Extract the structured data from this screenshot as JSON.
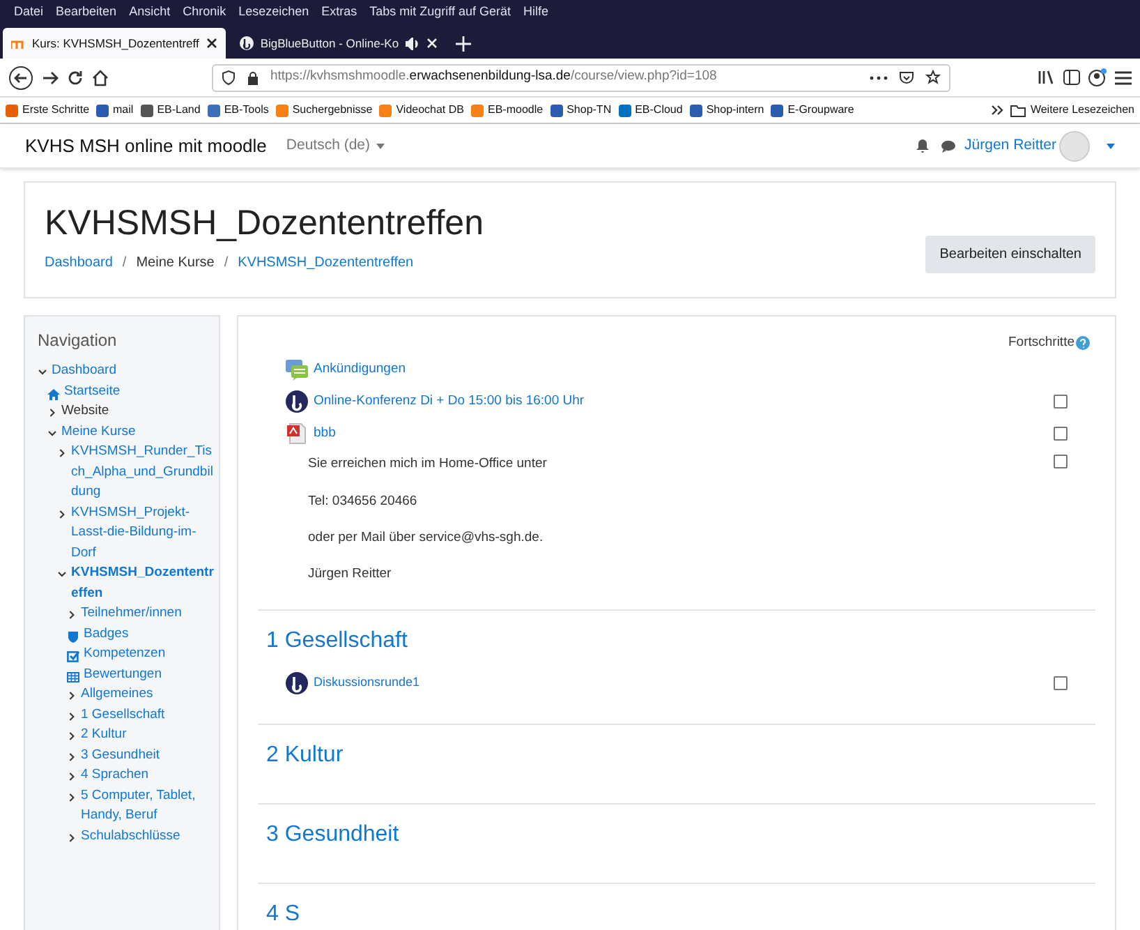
{
  "menu_bar": [
    "Datei",
    "Bearbeiten",
    "Ansicht",
    "Chronik",
    "Lesezeichen",
    "Extras",
    "Tabs mit Zugriff auf Gerät",
    "Hilfe"
  ],
  "tabs": [
    {
      "label": "Kurs: KVHSMSH_Dozententreff",
      "selected": true,
      "audio": false
    },
    {
      "label": "BigBlueButton - Online-Ko",
      "selected": false,
      "audio": true
    }
  ],
  "address": {
    "host": "https://kvhsmshmoodle.",
    "domain": "erwachsenenbildung-lsa.de",
    "path": "/course/view.php?id=108"
  },
  "bookmarks": [
    "Erste Schritte",
    "mail",
    "EB-Land",
    "EB-Tools",
    "Suchergebnisse",
    "Videochat DB",
    "EB-moodle",
    "Shop-TN",
    "EB-Cloud",
    "Shop-intern",
    "E-Groupware"
  ],
  "bookmarks_more": "Weitere Lesezeichen",
  "site": {
    "name": "KVHS MSH online mit moodle",
    "language": "Deutsch (de)",
    "user": "Jürgen Reitter"
  },
  "course": {
    "title": "KVHSMSH_Dozententreffen",
    "breadcrumb": [
      {
        "label": "Dashboard",
        "link": true
      },
      {
        "separator": "/",
        "label": "Meine Kurse",
        "link": false
      },
      {
        "separator": "/",
        "label": "KVHSMSH_Dozententreffen",
        "link": true
      }
    ],
    "edit_button": "Bearbeiten einschalten"
  },
  "navigation": {
    "title": "Navigation",
    "items": [
      {
        "label": "Dashboard",
        "kind": "branch",
        "expanded": true,
        "children": [
          {
            "label": "Startseite",
            "kind": "home"
          },
          {
            "label": "Website",
            "kind": "branch",
            "expanded": false
          },
          {
            "label": "Meine Kurse",
            "kind": "branch",
            "expanded": true,
            "children": [
              {
                "label": "KVHSMSH_Runder_Tisch_Alpha_und_Grundbildung",
                "kind": "branch",
                "expanded": false
              },
              {
                "label": "KVHSMSH_Projekt-Lasst-die-Bildung-im-Dorf",
                "kind": "branch",
                "expanded": false
              },
              {
                "label": "KVHSMSH_Dozententreffen",
                "kind": "branch",
                "expanded": true,
                "current": true,
                "children": [
                  {
                    "label": "Teilnehmer/innen",
                    "kind": "branch",
                    "expanded": false
                  },
                  {
                    "label": "Badges",
                    "kind": "badge"
                  },
                  {
                    "label": "Kompetenzen",
                    "kind": "check"
                  },
                  {
                    "label": "Bewertungen",
                    "kind": "table"
                  },
                  {
                    "label": "Allgemeines",
                    "kind": "branch",
                    "expanded": false
                  },
                  {
                    "label": "1 Gesellschaft",
                    "kind": "branch",
                    "expanded": false
                  },
                  {
                    "label": "2 Kultur",
                    "kind": "branch",
                    "expanded": false
                  },
                  {
                    "label": "3 Gesundheit",
                    "kind": "branch",
                    "expanded": false
                  },
                  {
                    "label": "4 Sprachen",
                    "kind": "branch",
                    "expanded": false
                  },
                  {
                    "label": "5 Computer, Tablet, Handy, Beruf",
                    "kind": "branch",
                    "expanded": false
                  },
                  {
                    "label": "Schulabschlüsse",
                    "kind": "branch",
                    "expanded": false
                  }
                ]
              }
            ]
          }
        ]
      }
    ]
  },
  "progress_label": "Fortschritte",
  "sections": [
    {
      "items": [
        {
          "kind": "forum",
          "label": "Ankündigungen"
        },
        {
          "kind": "bbb",
          "label": "Online-Konferenz Di + Do 15:00 bis 16:00 Uhr",
          "checked": false
        },
        {
          "kind": "pdf",
          "label": "bbb",
          "checked": false
        },
        {
          "kind": "text",
          "lines": [
            "Sie erreichen mich im Home-Office unter",
            "Tel: 034656 20466",
            "oder per Mail über service@vhs-sgh.de.",
            "Jürgen Reitter"
          ],
          "checked": false
        }
      ]
    },
    {
      "title": "1 Gesellschaft",
      "items": [
        {
          "kind": "bbb",
          "label": "Diskussionsrunde1",
          "checked": false
        }
      ]
    },
    {
      "title": "2 Kultur"
    },
    {
      "title": "3 Gesundheit"
    },
    {
      "title": "4 S"
    }
  ]
}
